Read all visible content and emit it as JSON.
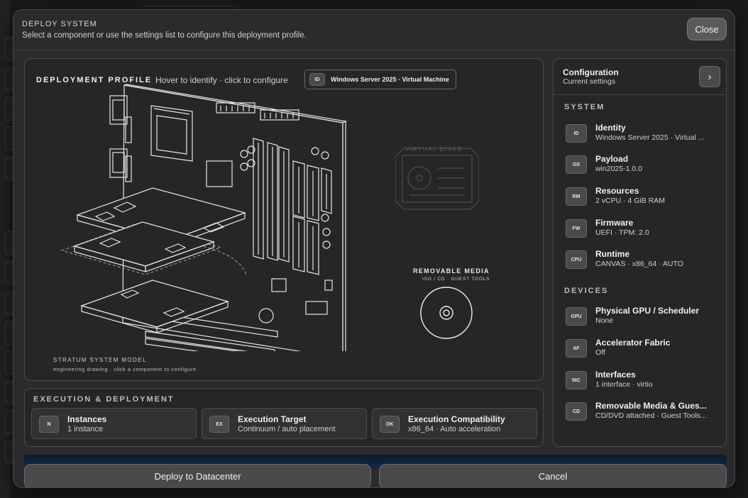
{
  "modal": {
    "title": "DEPLOY SYSTEM",
    "subtitle": "Select a component or use the settings list to configure this deployment profile.",
    "close_label": "Close"
  },
  "profile": {
    "title": "DEPLOYMENT PROFILE",
    "hint": "Hover to identify · click to configure",
    "badge_tag": "ID",
    "badge_text": "Windows Server 2025 · Virtual Machine",
    "virtual_disks_label": "VIRTUAL DISKS",
    "removable_media_title": "REMOVABLE MEDIA",
    "removable_media_sub": "ISO / CD · GUEST TOOLS",
    "model_title": "STRATUM SYSTEM MODEL",
    "model_sub": "engineering drawing · click a component to configure"
  },
  "execution": {
    "title": "EXECUTION & DEPLOYMENT",
    "items": [
      {
        "tag": "N",
        "label": "Instances",
        "value": "1 instance"
      },
      {
        "tag": "EX",
        "label": "Execution Target",
        "value": "Continuum / auto placement"
      },
      {
        "tag": "OK",
        "label": "Execution Compatibility",
        "value": "x86_64 · Auto acceleration"
      }
    ]
  },
  "config": {
    "title": "Configuration",
    "subtitle": "Current settings",
    "next_icon": "chevron-right-icon",
    "system_label": "SYSTEM",
    "system_items": [
      {
        "tag": "ID",
        "label": "Identity",
        "value": "Windows Server 2025 · Virtual ..."
      },
      {
        "tag": "OS",
        "label": "Payload",
        "value": "win2025-1.0.0"
      },
      {
        "tag": "RM",
        "label": "Resources",
        "value": "2 vCPU · 4 GiB RAM"
      },
      {
        "tag": "FW",
        "label": "Firmware",
        "value": "UEFI · TPM: 2.0"
      },
      {
        "tag": "CPU",
        "label": "Runtime",
        "value": "CANVAS · x86_64 · AUTO"
      }
    ],
    "devices_label": "DEVICES",
    "device_items": [
      {
        "tag": "GPU",
        "label": "Physical GPU / Scheduler",
        "value": "None"
      },
      {
        "tag": "AF",
        "label": "Accelerator Fabric",
        "value": "Off"
      },
      {
        "tag": "NIC",
        "label": "Interfaces",
        "value": "1 interface · virtio"
      },
      {
        "tag": "CD",
        "label": "Removable Media & Gues...",
        "value": "CD/DVD attached · Guest Tools..."
      }
    ]
  },
  "actions": {
    "deploy_label": "Deploy to Datacenter",
    "cancel_label": "Cancel"
  },
  "colors": {
    "panel": "#262628",
    "modal": "#2b2b2d",
    "accent_glow": "#122846",
    "drawing_line": "#e6e6e6",
    "drawing_dashed": "#7f9a86"
  }
}
